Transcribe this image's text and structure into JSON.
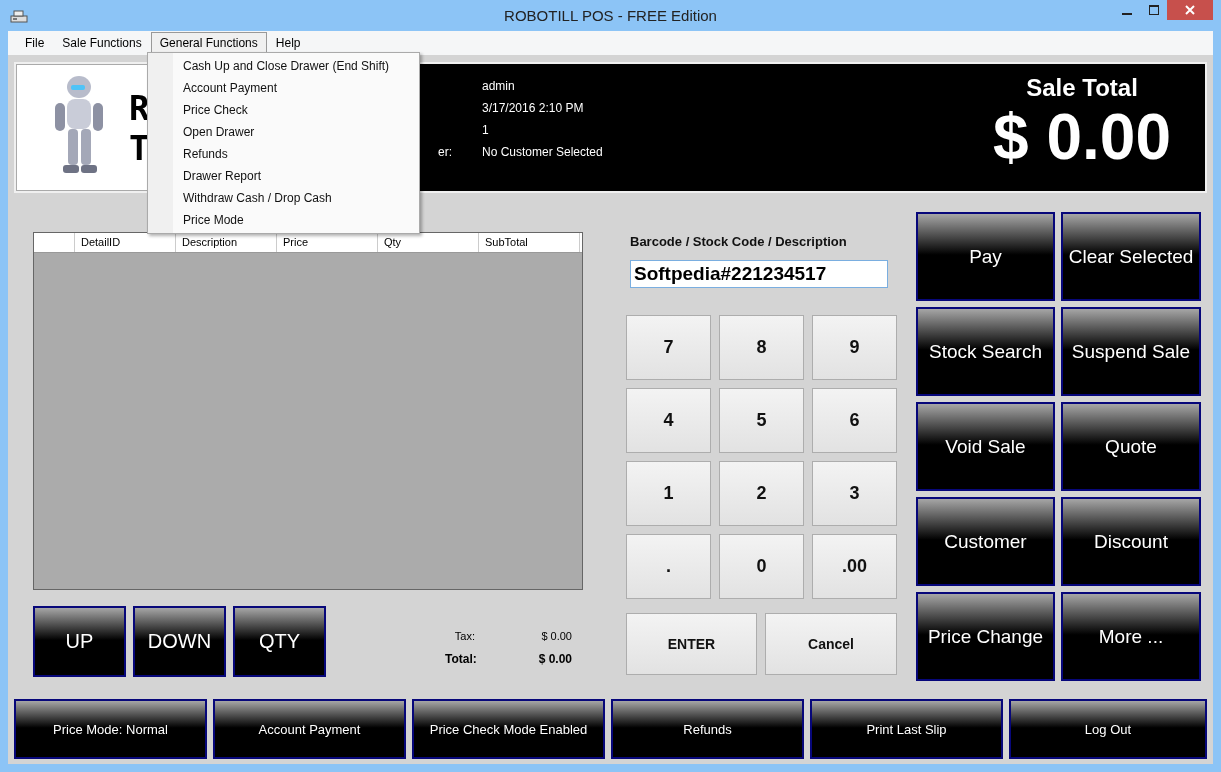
{
  "window": {
    "title": "ROBOTILL POS - FREE Edition"
  },
  "menu": [
    {
      "label": "File",
      "selected": false
    },
    {
      "label": "Sale Functions",
      "selected": false
    },
    {
      "label": "General Functions",
      "selected": true
    },
    {
      "label": "Help",
      "selected": false
    }
  ],
  "open_menu": {
    "items": [
      "Cash Up and Close Drawer (End Shift)",
      "Account Payment",
      "Price Check",
      "Open Drawer",
      "Refunds",
      "Drawer Report",
      "Withdraw Cash / Drop Cash",
      "Price Mode"
    ]
  },
  "header": {
    "logo_letters": [
      "R",
      "T"
    ],
    "info": [
      {
        "value": "admin"
      },
      {
        "value": "3/17/2016 2:10 PM"
      },
      {
        "value": "1"
      },
      {
        "label": "er:",
        "value": "No Customer Selected"
      }
    ],
    "sale_total_title": "Sale Total",
    "sale_total": "$ 0.00"
  },
  "grid": {
    "columns": [
      "DetailID",
      "Description",
      "Price",
      "Qty",
      "SubTotal"
    ]
  },
  "line_buttons": [
    "UP",
    "DOWN",
    "QTY"
  ],
  "totals": [
    {
      "label": "Tax:",
      "value": "$ 0.00",
      "kind": "normal"
    },
    {
      "label": "Total:",
      "value": "$ 0.00",
      "kind": "bold"
    }
  ],
  "entry": {
    "label": "Barcode / Stock Code / Description",
    "value": "Softpedia#221234517"
  },
  "keypad": [
    "7",
    "8",
    "9",
    "4",
    "5",
    "6",
    "1",
    "2",
    "3",
    ".",
    "0",
    ".00"
  ],
  "keypad_actions": [
    "ENTER",
    "Cancel"
  ],
  "actions": [
    "Pay",
    "Clear Selected",
    "Stock Search",
    "Suspend Sale",
    "Void Sale",
    "Quote",
    "Customer",
    "Discount",
    "Price Change",
    "More ..."
  ],
  "footer_buttons": [
    "Price Mode: Normal",
    "Account Payment",
    "Price Check Mode Enabled",
    "Refunds",
    "Print Last Slip",
    "Log Out"
  ]
}
